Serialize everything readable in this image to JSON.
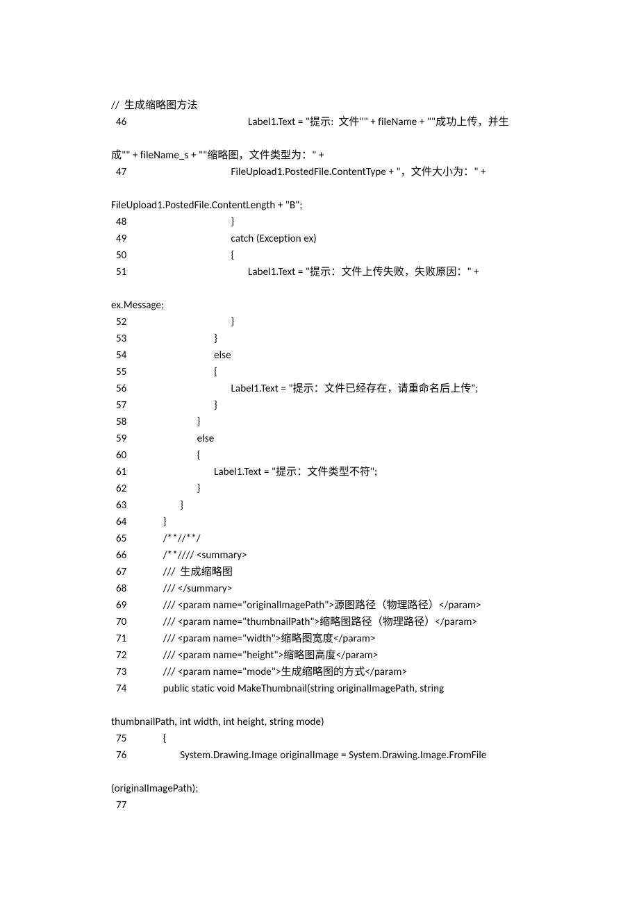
{
  "header": "//  生成缩略图方法",
  "lines": [
    {
      "num": "46",
      "indent": "                                           ",
      "text": "Label1.Text = \"提示:  文件\"\" + fileName + \"\"成功上传，并生"
    },
    {
      "num": "",
      "indent": "",
      "text": "",
      "blank": true
    },
    {
      "num": "",
      "indent": "",
      "text": "成\"\" + fileName_s + \"\"缩略图，文件类型为：\" +",
      "noNum": true
    },
    {
      "num": "47",
      "indent": "                                    ",
      "text": "FileUpload1.PostedFile.ContentType + \"，文件大小为：\" +"
    },
    {
      "num": "",
      "indent": "",
      "text": "",
      "blank": true
    },
    {
      "num": "",
      "indent": "",
      "text": "FileUpload1.PostedFile.ContentLength + \"B\";",
      "noNum": true
    },
    {
      "num": "48",
      "indent": "                                    ",
      "text": "}"
    },
    {
      "num": "49",
      "indent": "                                    ",
      "text": "catch (Exception ex)"
    },
    {
      "num": "50",
      "indent": "                                    ",
      "text": "{"
    },
    {
      "num": "51",
      "indent": "                                           ",
      "text": "Label1.Text = \"提示：文件上传失败，失败原因：\" +"
    },
    {
      "num": "",
      "indent": "",
      "text": "",
      "blank": true
    },
    {
      "num": "",
      "indent": "",
      "text": "ex.Message;",
      "noNum": true
    },
    {
      "num": "52",
      "indent": "                                    ",
      "text": "}"
    },
    {
      "num": "53",
      "indent": "                             ",
      "text": "}"
    },
    {
      "num": "54",
      "indent": "                             ",
      "text": "else"
    },
    {
      "num": "55",
      "indent": "                             ",
      "text": "{"
    },
    {
      "num": "56",
      "indent": "                                    ",
      "text": "Label1.Text = \"提示：文件已经存在，请重命名后上传\";"
    },
    {
      "num": "57",
      "indent": "                             ",
      "text": "}"
    },
    {
      "num": "58",
      "indent": "                      ",
      "text": "}"
    },
    {
      "num": "59",
      "indent": "                      ",
      "text": "else"
    },
    {
      "num": "60",
      "indent": "                      ",
      "text": "{"
    },
    {
      "num": "61",
      "indent": "                             ",
      "text": "Label1.Text = \"提示：文件类型不符\";"
    },
    {
      "num": "62",
      "indent": "                      ",
      "text": "}"
    },
    {
      "num": "63",
      "indent": "               ",
      "text": "}"
    },
    {
      "num": "64",
      "indent": "        ",
      "text": "}"
    },
    {
      "num": "65",
      "indent": "        ",
      "text": "/**//**/"
    },
    {
      "num": "66",
      "indent": "        ",
      "text": "/**//// <summary>"
    },
    {
      "num": "67",
      "indent": "        ",
      "text": "///  生成缩略图"
    },
    {
      "num": "68",
      "indent": "        ",
      "text": "/// </summary>"
    },
    {
      "num": "69",
      "indent": "        ",
      "text": "/// <param name=\"originalImagePath\">源图路径（物理路径）</param>"
    },
    {
      "num": "70",
      "indent": "        ",
      "text": "/// <param name=\"thumbnailPath\">缩略图路径（物理路径）</param>"
    },
    {
      "num": "71",
      "indent": "        ",
      "text": "/// <param name=\"width\">缩略图宽度</param>"
    },
    {
      "num": "72",
      "indent": "        ",
      "text": "/// <param name=\"height\">缩略图高度</param>"
    },
    {
      "num": "73",
      "indent": "        ",
      "text": "/// <param name=\"mode\">生成缩略图的方式</param>"
    },
    {
      "num": "74",
      "indent": "        ",
      "text": "public static void MakeThumbnail(string originalImagePath, string"
    },
    {
      "num": "",
      "indent": "",
      "text": "",
      "blank": true
    },
    {
      "num": "",
      "indent": "",
      "text": "thumbnailPath, int width, int height, string mode)",
      "noNum": true
    },
    {
      "num": "75",
      "indent": "        ",
      "text": "{"
    },
    {
      "num": "76",
      "indent": "               ",
      "text": "System.Drawing.Image originalImage = System.Drawing.Image.FromFile"
    },
    {
      "num": "",
      "indent": "",
      "text": "",
      "blank": true
    },
    {
      "num": "",
      "indent": "",
      "text": "(originalImagePath);",
      "noNum": true
    },
    {
      "num": "77",
      "indent": "       ",
      "text": ""
    }
  ]
}
